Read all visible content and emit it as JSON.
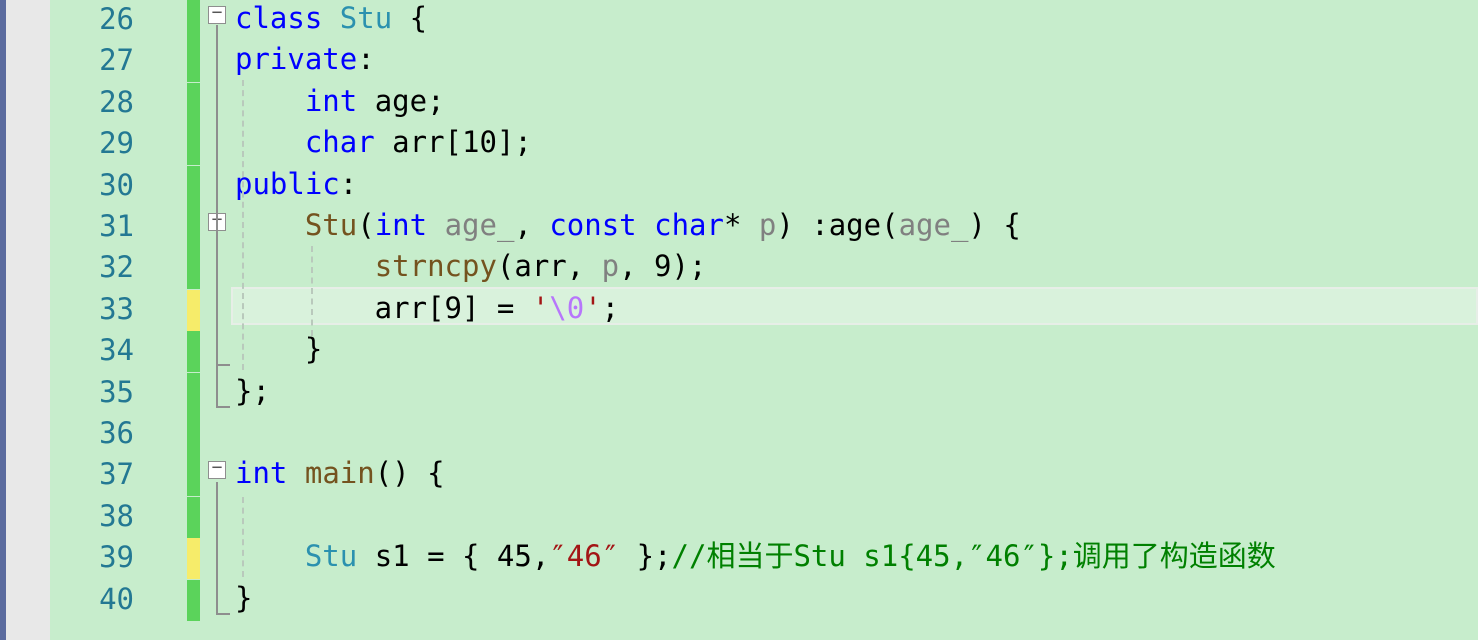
{
  "editor": {
    "colors": {
      "background": "#c7edcc",
      "line_number": "#237893",
      "change_saved": "#5bd35b",
      "change_unsaved": "#f6ec6a",
      "keyword": "#0000ff",
      "type": "#2b91af",
      "function": "#74531f",
      "parameter": "#808080",
      "string": "#a31515",
      "comment": "#008000"
    },
    "cursor_line_number": "33",
    "lines": [
      {
        "num": "26",
        "change": "saved",
        "fold": "collapse-icon",
        "tokens": [
          {
            "text": "class",
            "cls": "kw"
          },
          {
            "text": " "
          },
          {
            "text": "Stu",
            "cls": "ty"
          },
          {
            "text": " {"
          }
        ]
      },
      {
        "num": "27",
        "change": "saved",
        "tokens": [
          {
            "text": "private",
            "cls": "kw"
          },
          {
            "text": ":"
          }
        ]
      },
      {
        "num": "28",
        "change": "saved",
        "tokens": [
          {
            "text": "    "
          },
          {
            "text": "int",
            "cls": "kw"
          },
          {
            "text": " age;"
          }
        ]
      },
      {
        "num": "29",
        "change": "saved",
        "tokens": [
          {
            "text": "    "
          },
          {
            "text": "char",
            "cls": "kw"
          },
          {
            "text": " arr[10];"
          }
        ]
      },
      {
        "num": "30",
        "change": "saved",
        "tokens": [
          {
            "text": "public",
            "cls": "kw"
          },
          {
            "text": ":"
          }
        ]
      },
      {
        "num": "31",
        "change": "saved",
        "fold": "collapse-icon",
        "tokens": [
          {
            "text": "    "
          },
          {
            "text": "Stu",
            "cls": "fn"
          },
          {
            "text": "("
          },
          {
            "text": "int",
            "cls": "kw"
          },
          {
            "text": " "
          },
          {
            "text": "age_",
            "cls": "pr"
          },
          {
            "text": ", "
          },
          {
            "text": "const",
            "cls": "kw"
          },
          {
            "text": " "
          },
          {
            "text": "char",
            "cls": "kw"
          },
          {
            "text": "* "
          },
          {
            "text": "p",
            "cls": "pr"
          },
          {
            "text": ") :age("
          },
          {
            "text": "age_",
            "cls": "pr"
          },
          {
            "text": ") {"
          }
        ]
      },
      {
        "num": "32",
        "change": "saved",
        "tokens": [
          {
            "text": "        "
          },
          {
            "text": "strncpy",
            "cls": "fn"
          },
          {
            "text": "(arr, "
          },
          {
            "text": "p",
            "cls": "pr"
          },
          {
            "text": ", 9);"
          }
        ]
      },
      {
        "num": "33",
        "change": "unsaved",
        "tokens": [
          {
            "text": "        arr[9] = "
          },
          {
            "text": "'",
            "cls": "st"
          },
          {
            "text": "\\0",
            "cls": "es"
          },
          {
            "text": "'",
            "cls": "st"
          },
          {
            "text": ";"
          }
        ]
      },
      {
        "num": "34",
        "change": "saved",
        "tokens": [
          {
            "text": "    }"
          }
        ]
      },
      {
        "num": "35",
        "change": "saved",
        "tokens": [
          {
            "text": "};"
          }
        ]
      },
      {
        "num": "36",
        "change": "saved",
        "tokens": []
      },
      {
        "num": "37",
        "change": "saved",
        "fold": "collapse-icon",
        "tokens": [
          {
            "text": "int",
            "cls": "kw"
          },
          {
            "text": " "
          },
          {
            "text": "main",
            "cls": "fn"
          },
          {
            "text": "() {"
          }
        ]
      },
      {
        "num": "38",
        "change": "saved",
        "tokens": []
      },
      {
        "num": "39",
        "change": "unsaved",
        "tokens": [
          {
            "text": "    "
          },
          {
            "text": "Stu",
            "cls": "ty"
          },
          {
            "text": " s1 = { 45,"
          },
          {
            "text": "″46″",
            "cls": "st"
          },
          {
            "text": " };"
          },
          {
            "text": "//相当于Stu s1{45,″46″};调用了构造函数",
            "cls": "cm"
          }
        ]
      },
      {
        "num": "40",
        "change": "saved",
        "tokens": [
          {
            "text": "}"
          }
        ]
      }
    ]
  }
}
